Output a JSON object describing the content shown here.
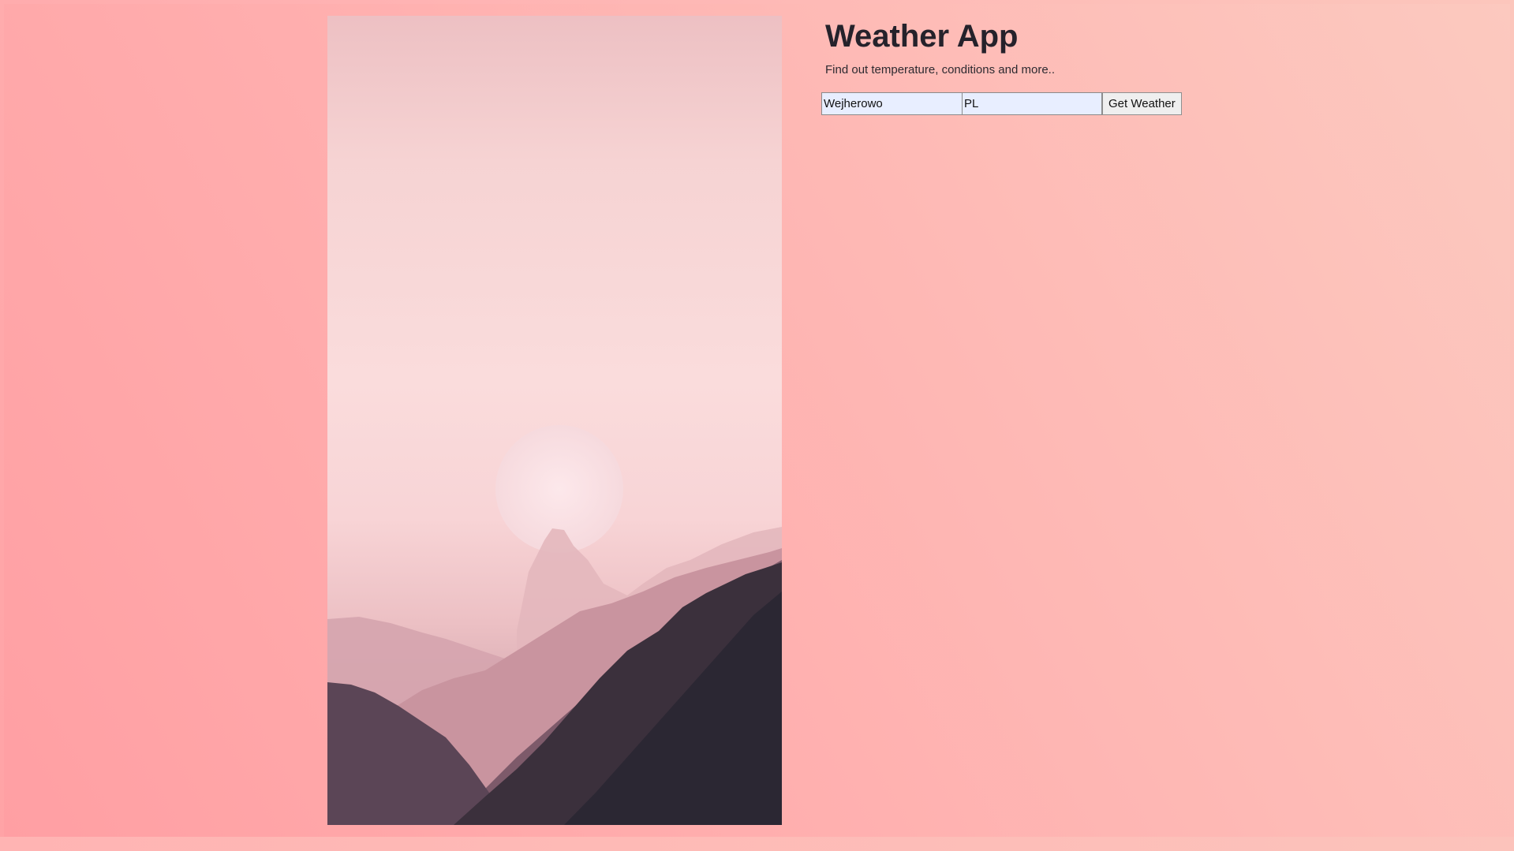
{
  "app": {
    "title": "Weather App",
    "subtitle": "Find out temperature, conditions and more.."
  },
  "form": {
    "city_value": "Wejherowo",
    "country_value": "PL",
    "submit_label": "Get Weather"
  },
  "colors": {
    "background_gradient_start": "#ffa3a6",
    "background_gradient_end": "#fcc6bc",
    "title_color": "#25222b"
  }
}
